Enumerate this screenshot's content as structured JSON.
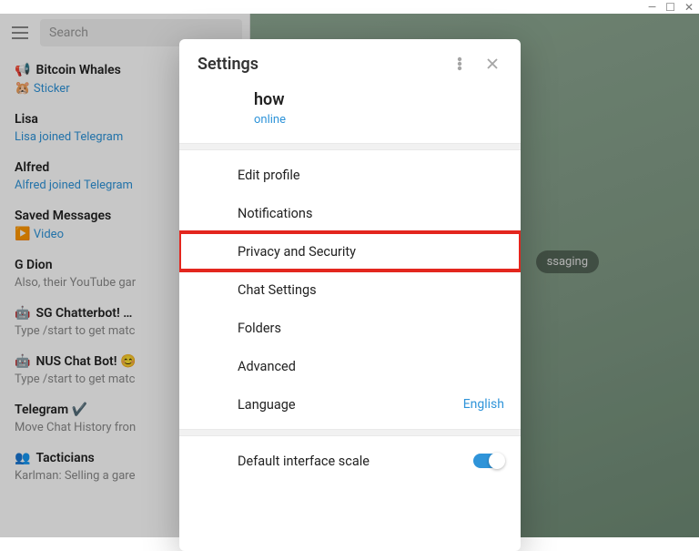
{
  "window": {
    "minimize": "—",
    "maximize": "☐",
    "close": "✕"
  },
  "search": {
    "placeholder": "Search"
  },
  "chats": [
    {
      "icon": "📢",
      "title": "Bitcoin Whales",
      "sub_icon": "🐹",
      "subtitle": "Sticker",
      "sub_gray": false
    },
    {
      "icon": "",
      "title": "Lisa",
      "sub_icon": "",
      "subtitle": "Lisa joined Telegram",
      "sub_gray": false
    },
    {
      "icon": "",
      "title": "Alfred",
      "sub_icon": "",
      "subtitle": "Alfred joined Telegram",
      "sub_gray": false
    },
    {
      "icon": "",
      "title": "Saved Messages",
      "sub_icon": "▶️",
      "subtitle": "Video",
      "sub_gray": false
    },
    {
      "icon": "",
      "title": "G Dion",
      "sub_icon": "",
      "subtitle": "Also, their YouTube gar",
      "sub_gray": true
    },
    {
      "icon": "🤖",
      "title": "SG Chatterbot! …",
      "sub_icon": "",
      "subtitle": "Type /start to get matc",
      "sub_gray": true
    },
    {
      "icon": "🤖",
      "title": "NUS Chat Bot! 😊",
      "sub_icon": "",
      "subtitle": "Type /start to get matc",
      "sub_gray": true
    },
    {
      "icon": "",
      "title": "Telegram ✔️",
      "sub_icon": "",
      "subtitle": "Move Chat History fron",
      "sub_gray": true
    },
    {
      "icon": "👥",
      "title": "Tacticians",
      "sub_icon": "",
      "subtitle": "Karlman: Selling a gare",
      "sub_gray": true
    }
  ],
  "pill": "ssaging",
  "settings": {
    "title": "Settings",
    "profile_name": "how",
    "profile_status": "online",
    "items": [
      {
        "key": "edit-profile",
        "label": "Edit profile",
        "value": ""
      },
      {
        "key": "notifications",
        "label": "Notifications",
        "value": ""
      },
      {
        "key": "privacy",
        "label": "Privacy and Security",
        "value": ""
      },
      {
        "key": "chat-settings",
        "label": "Chat Settings",
        "value": ""
      },
      {
        "key": "folders",
        "label": "Folders",
        "value": ""
      },
      {
        "key": "advanced",
        "label": "Advanced",
        "value": ""
      },
      {
        "key": "language",
        "label": "Language",
        "value": "English"
      }
    ],
    "scale_label": "Default interface scale"
  }
}
